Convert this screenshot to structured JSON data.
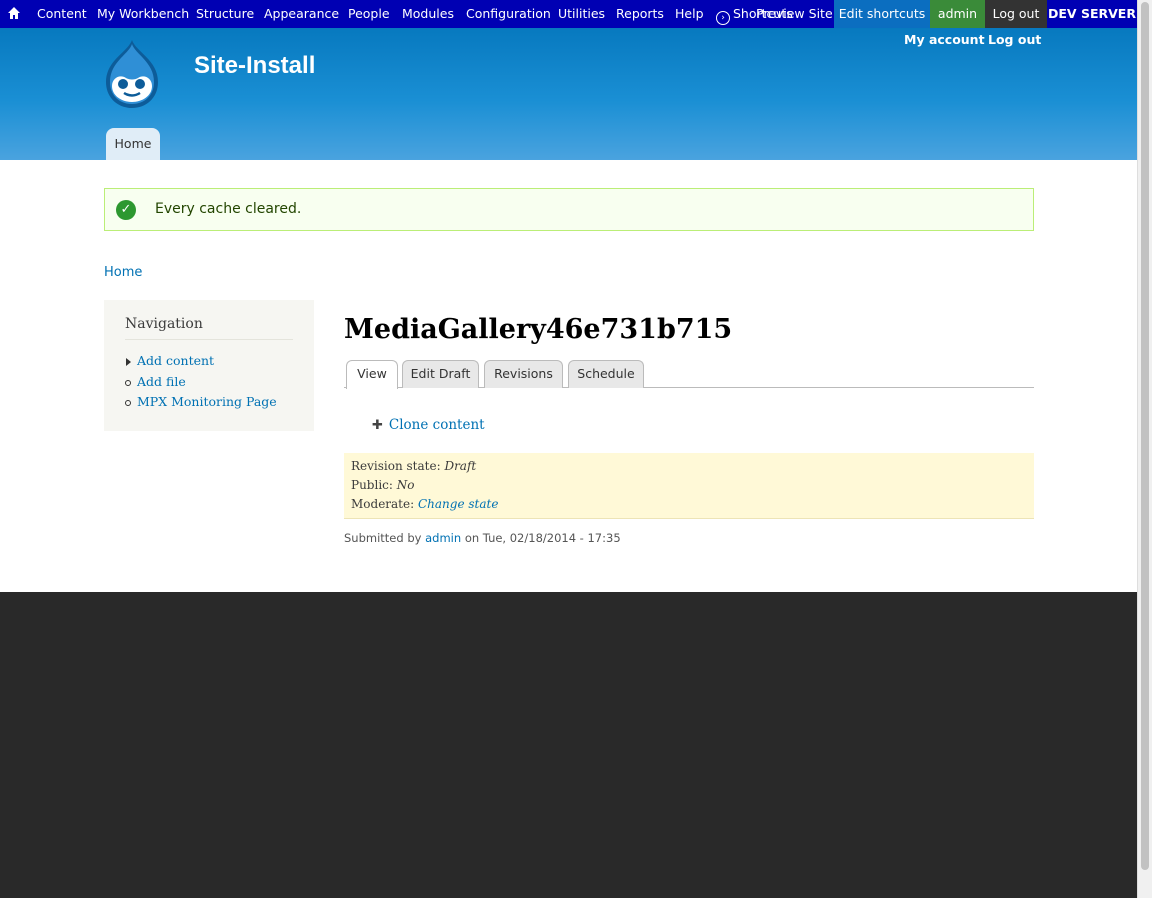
{
  "toolbar": {
    "home_icon": "home-icon",
    "items": [
      "Content",
      "My Workbench",
      "Structure",
      "Appearance",
      "People",
      "Modules",
      "Configuration",
      "Utilities",
      "Reports",
      "Help"
    ],
    "shortcuts_label": "Shortcuts",
    "preview_site": "Preview Site",
    "edit_shortcuts": "Edit shortcuts",
    "user": "admin",
    "logout": "Log out",
    "env": "DEV SERVER"
  },
  "header": {
    "site_name": "Site-Install",
    "my_account": "My account",
    "logout": "Log out",
    "primary_tab": "Home"
  },
  "message": {
    "text": "Every cache cleared."
  },
  "breadcrumb": "Home",
  "sidebar": {
    "title": "Navigation",
    "items": [
      "Add content",
      "Add file",
      "MPX Monitoring Page"
    ]
  },
  "main": {
    "title": "MediaGallery46e731b715",
    "tabs": [
      "View",
      "Edit Draft",
      "Revisions",
      "Schedule"
    ],
    "clone_link": "Clone content",
    "workbench": {
      "revision_state_label": "Revision state:",
      "revision_state_value": "Draft",
      "public_label": "Public:",
      "public_value": "No",
      "moderate_label": "Moderate:",
      "moderate_value": "Change state"
    },
    "submitted": {
      "prefix": "Submitted by",
      "user": "admin",
      "date": "on Tue, 02/18/2014 - 17:35"
    }
  },
  "colors": {
    "toolbar_bg": "#0000b3",
    "header_top": "#0779bf",
    "admin_bg": "#3a8b39",
    "link": "#0071b3",
    "footer_bg": "#292929"
  }
}
